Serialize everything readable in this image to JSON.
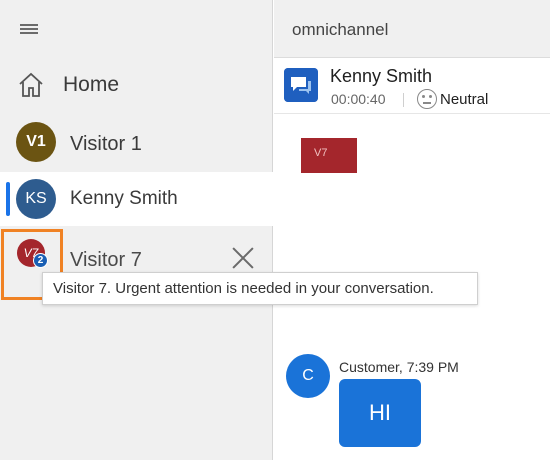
{
  "nav": {
    "home_label": "Home"
  },
  "sessions": [
    {
      "initials": "V1",
      "name": "Visitor 1",
      "color": "#6b5412"
    },
    {
      "initials": "KS",
      "name": "Kenny Smith",
      "color": "#2e5c8f",
      "active": true
    },
    {
      "initials": "V7",
      "name": "Visitor 7",
      "color": "#a4262c",
      "badge_count": "2"
    }
  ],
  "tooltip": {
    "text": "Visitor 7. Urgent attention is needed in your conversation."
  },
  "top_bar": {
    "title": "omnichannel"
  },
  "conversation": {
    "customer_name": "Kenny Smith",
    "timer": "00:00:40",
    "sentiment": "Neutral",
    "tag": "V7",
    "message": {
      "avatar_initial": "C",
      "sender_time": "Customer, 7:39 PM",
      "text": "HI"
    }
  },
  "colors": {
    "accent": "#1a73d8",
    "highlight": "#f08224",
    "urgent": "#a4262c"
  },
  "icons": [
    "hamburger-icon",
    "home-icon",
    "close-icon",
    "chat-icon",
    "neutral-face-icon"
  ]
}
